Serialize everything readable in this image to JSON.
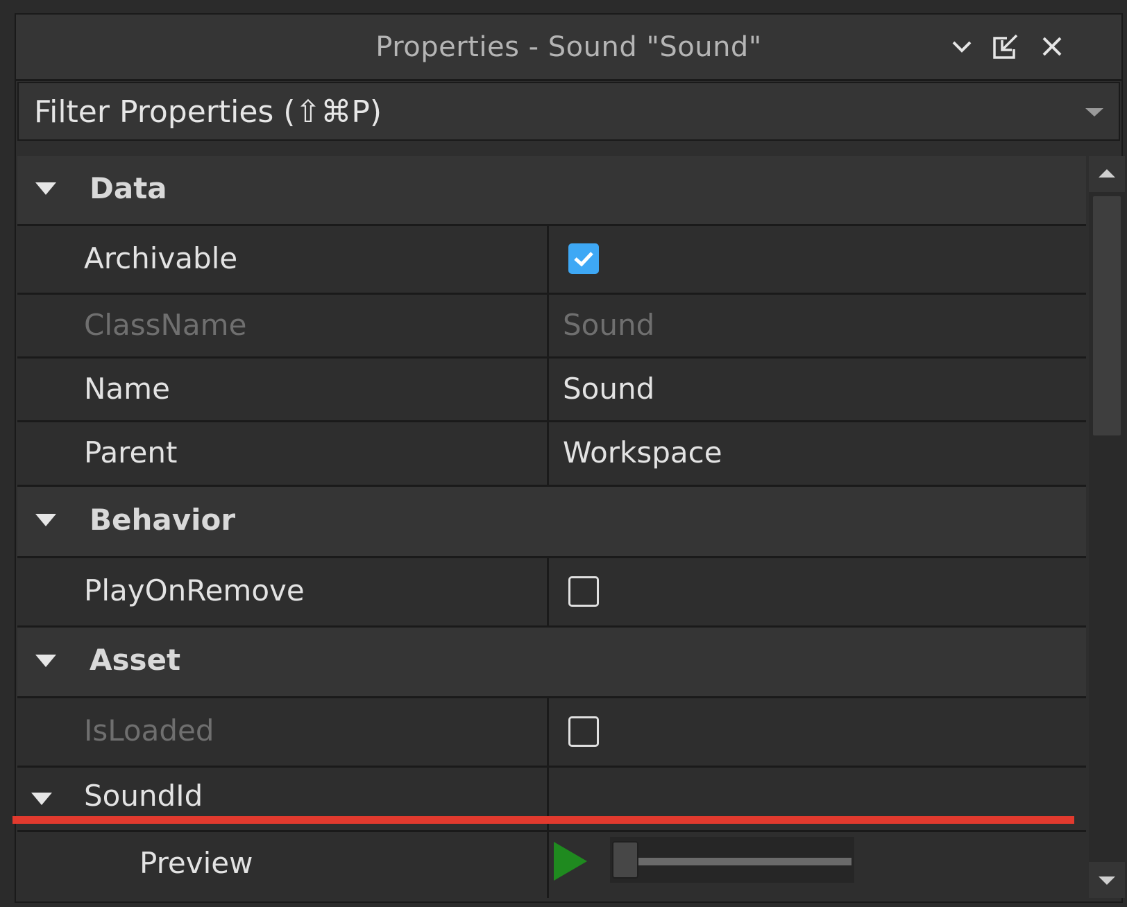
{
  "window": {
    "title": "Properties - Sound \"Sound\""
  },
  "filter": {
    "placeholder": "Filter Properties (⇧⌘P)"
  },
  "sections": {
    "data": {
      "label": "Data",
      "archivable": {
        "name": "Archivable",
        "checked": true
      },
      "classname": {
        "name": "ClassName",
        "value": "Sound"
      },
      "name": {
        "name": "Name",
        "value": "Sound"
      },
      "parent": {
        "name": "Parent",
        "value": "Workspace"
      }
    },
    "behavior": {
      "label": "Behavior",
      "playonremove": {
        "name": "PlayOnRemove",
        "checked": false
      }
    },
    "asset": {
      "label": "Asset",
      "isloaded": {
        "name": "IsLoaded",
        "checked": false
      },
      "soundid": {
        "name": "SoundId"
      },
      "preview": {
        "name": "Preview"
      }
    }
  },
  "colors": {
    "checkbox_on": "#3ea8f5",
    "play_icon": "#1f8a1f",
    "highlight_line": "#e23a2e"
  },
  "icons": [
    "chevron-down-icon",
    "dock-icon",
    "close-icon",
    "dropdown-arrow-icon",
    "collapse-arrow-icon",
    "checkmark-icon",
    "play-icon",
    "scroll-up-icon",
    "scroll-down-icon"
  ]
}
